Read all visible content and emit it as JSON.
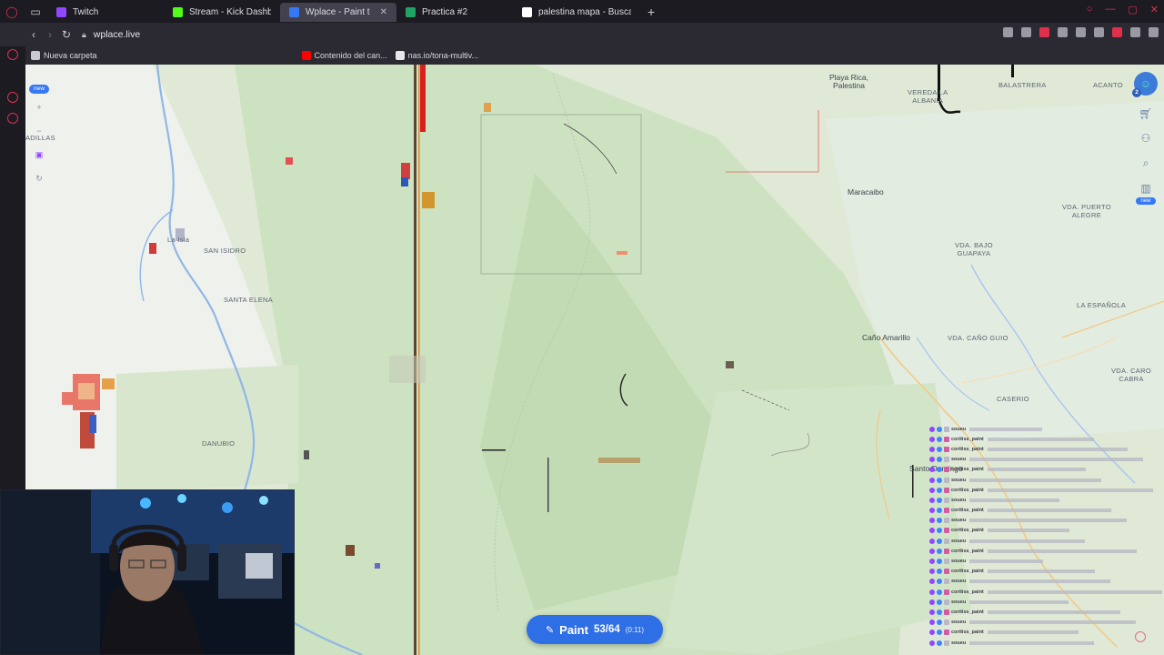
{
  "browser": {
    "tabs": [
      {
        "label": "Twitch",
        "color": "#9146ff",
        "active": false
      },
      {
        "label": "Stream - Kick Dashboard",
        "color": "#53fc18",
        "active": false
      },
      {
        "label": "Wplace - Paint the world",
        "color": "#3579f6",
        "active": true
      },
      {
        "label": "Practica #2",
        "color": "#1fa463",
        "active": false
      },
      {
        "label": "palestina mapa - Buscar c",
        "color": "#ffffff",
        "active": false
      }
    ],
    "url": "wplace.live",
    "bookmarks": {
      "folder": "Nueva carpeta",
      "contenido": "Contenido del can...",
      "nas": "nas.io/tona-multiv..."
    }
  },
  "map": {
    "places": [
      {
        "label": "Playa Rica,\nPalestina"
      },
      {
        "label": "VEREDA LA\nALBANIA"
      },
      {
        "label": "BALASTRERA"
      },
      {
        "label": "ACANTO"
      },
      {
        "label": "Maracaibo"
      },
      {
        "label": "VDA. PUERTO\nALEGRE"
      },
      {
        "label": "VDA. BAJO\nGUAPAYA"
      },
      {
        "label": "LA ESPAÑOLA"
      },
      {
        "label": "Caño Amarillo"
      },
      {
        "label": "VDA. CAÑO GUIO"
      },
      {
        "label": "VDA. CARO\nCABRA"
      },
      {
        "label": "CASERIO"
      },
      {
        "label": "Santo Domingo"
      },
      {
        "label": "SAN ISIDRO"
      },
      {
        "label": "SANTA ELENA"
      },
      {
        "label": "DANUBIO"
      },
      {
        "label": "La Isla"
      },
      {
        "label": "ADILLAS"
      }
    ],
    "toolbar_badge": "new",
    "right_badge": "new",
    "user_level": "2",
    "colors": {
      "land": "#dfe9d6",
      "forest": "#c9e0bd",
      "river": "#8fb7e8",
      "road": "#f2c986",
      "accent": "#3579f6"
    }
  },
  "paint": {
    "label": "Paint",
    "count": "53/64",
    "timer": "(0:11)"
  },
  "chat": {
    "lines": [
      {
        "user": "soueu",
        "msg": "",
        "color": "#b8b8c8"
      },
      {
        "user": "coritiss_paint",
        "msg": "",
        "color": "#d45aa8"
      },
      {
        "user": "coritiss_paint",
        "msg": "",
        "color": "#d45aa8"
      },
      {
        "user": "soueu",
        "msg": "",
        "color": "#b8b8c8"
      },
      {
        "user": "coritiss_paint",
        "msg": "",
        "color": "#d45aa8"
      },
      {
        "user": "soueu",
        "msg": "",
        "color": "#b8b8c8"
      },
      {
        "user": "coritiss_paint",
        "msg": "",
        "color": "#d45aa8"
      },
      {
        "user": "soueu",
        "msg": "",
        "color": "#b8b8c8"
      },
      {
        "user": "coritiss_paint",
        "msg": "",
        "color": "#d45aa8"
      },
      {
        "user": "soueu",
        "msg": "",
        "color": "#b8b8c8"
      },
      {
        "user": "coritiss_paint",
        "msg": "",
        "color": "#d45aa8"
      },
      {
        "user": "soueu",
        "msg": "",
        "color": "#b8b8c8"
      },
      {
        "user": "coritiss_paint",
        "msg": "",
        "color": "#d45aa8"
      },
      {
        "user": "soueu",
        "msg": "",
        "color": "#b8b8c8"
      },
      {
        "user": "coritiss_paint",
        "msg": "",
        "color": "#d45aa8"
      },
      {
        "user": "soueu",
        "msg": "",
        "color": "#b8b8c8"
      },
      {
        "user": "coritiss_paint",
        "msg": "",
        "color": "#d45aa8"
      },
      {
        "user": "soueu",
        "msg": "",
        "color": "#b8b8c8"
      },
      {
        "user": "coritiss_paint",
        "msg": "",
        "color": "#d45aa8"
      },
      {
        "user": "soueu",
        "msg": "",
        "color": "#b8b8c8"
      },
      {
        "user": "coritiss_paint",
        "msg": "",
        "color": "#d45aa8"
      },
      {
        "user": "soueu",
        "msg": "",
        "color": "#b8b8c8"
      }
    ]
  }
}
